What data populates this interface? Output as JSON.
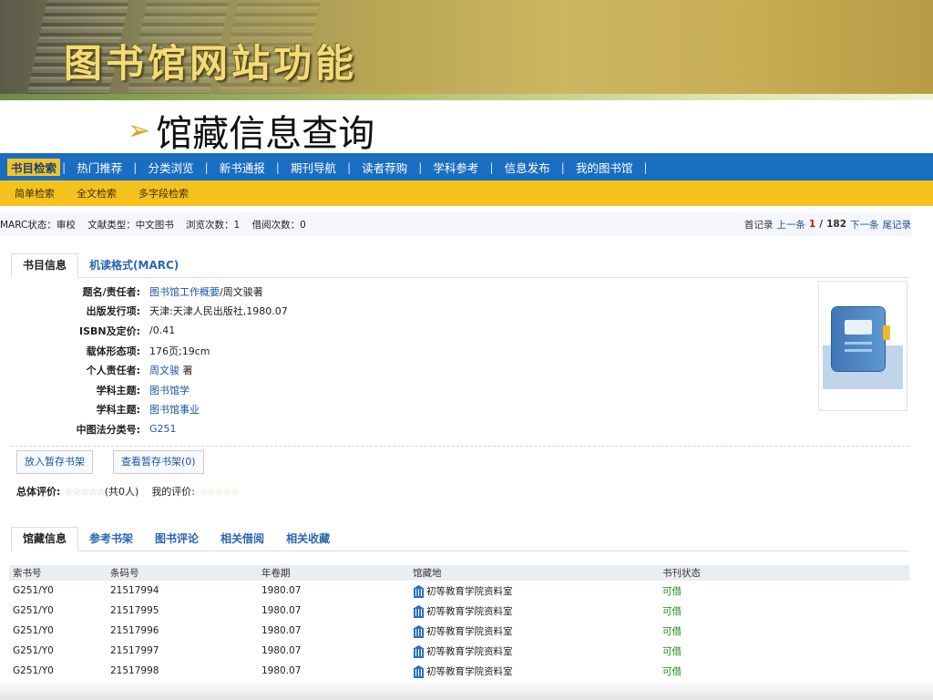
{
  "slide": {
    "title": "图书馆网站功能",
    "heading": "馆藏信息查询",
    "bullet_icon": "arrow-bullet-icon"
  },
  "nav": {
    "items": [
      "书目检索",
      "热门推荐",
      "分类浏览",
      "新书通报",
      "期刊导航",
      "读者荐购",
      "学科参考",
      "信息发布",
      "我的图书馆"
    ],
    "separator": "|"
  },
  "subnav": {
    "items": [
      "简单检索",
      "全文检索",
      "多字段检索"
    ]
  },
  "status": {
    "marc_status": "MARC状态：审校",
    "doc_type": "文献类型：中文图书",
    "views": "浏览次数：1",
    "loans": "借阅次数：0",
    "first": "首记录",
    "prev": "上一条",
    "current": "1",
    "slash": "/",
    "total": "182",
    "next": "下一条",
    "last": "尾记录"
  },
  "record_tabs": [
    "书目信息",
    "机读格式(MARC)"
  ],
  "record": {
    "fields": [
      {
        "label": "题名/责任者:",
        "link": "图书馆工作概要",
        "text": "/周文骏著"
      },
      {
        "label": "出版发行项:",
        "link": "",
        "text": "天津:天津人民出版社,1980.07"
      },
      {
        "label": "ISBN及定价:",
        "link": "",
        "text": "/0.41"
      },
      {
        "label": "载体形态项:",
        "link": "",
        "text": "176页;19cm"
      },
      {
        "label": "个人责任者:",
        "link": "周文骏",
        "text": " 著"
      },
      {
        "label": "学科主题:",
        "link": "图书馆学",
        "text": ""
      },
      {
        "label": "学科主题:",
        "link": "图书馆事业",
        "text": ""
      },
      {
        "label": "中图法分类号:",
        "link": "G251",
        "text": ""
      }
    ],
    "cover_icon": "book-cover-icon"
  },
  "buttons": {
    "add_shelf": "放入暂存书架",
    "view_shelf": "查看暂存书架(0)"
  },
  "rating": {
    "overall_label": "总体评价:",
    "overall_stars": "☆☆☆☆☆",
    "overall_count": "(共0人)",
    "my_label": "我的评价:",
    "my_stars": "☆☆☆☆☆"
  },
  "holding_tabs": [
    "馆藏信息",
    "参考书架",
    "图书评论",
    "相关借阅",
    "相关收藏"
  ],
  "holdings": {
    "headers": [
      "索书号",
      "条码号",
      "年卷期",
      "馆藏地",
      "书刊状态"
    ],
    "rows": [
      [
        "G251/Y0",
        "21517994",
        "1980.07",
        "初等教育学院资料室",
        "可借"
      ],
      [
        "G251/Y0",
        "21517995",
        "1980.07",
        "初等教育学院资料室",
        "可借"
      ],
      [
        "G251/Y0",
        "21517996",
        "1980.07",
        "初等教育学院资料室",
        "可借"
      ],
      [
        "G251/Y0",
        "21517997",
        "1980.07",
        "初等教育学院资料室",
        "可借"
      ],
      [
        "G251/Y0",
        "21517998",
        "1980.07",
        "初等教育学院资料室",
        "可借"
      ]
    ],
    "location_icon": "library-building-icon"
  }
}
